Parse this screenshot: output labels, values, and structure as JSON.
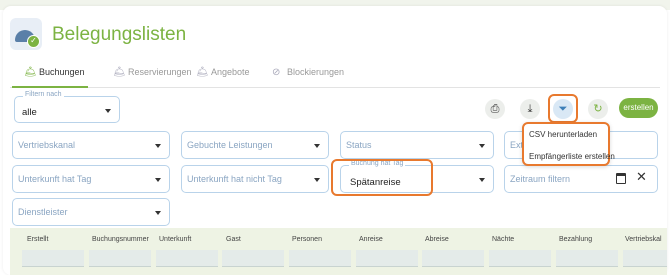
{
  "app": {
    "title": "Belegungslisten"
  },
  "tabs": [
    {
      "label": "Buchungen",
      "icon": "bell-icon"
    },
    {
      "label": "Reservierungen",
      "icon": "bell-icon"
    },
    {
      "label": "Angebote",
      "icon": "bell-icon"
    },
    {
      "label": "Blockierungen",
      "icon": "block-icon"
    }
  ],
  "filter": {
    "label": "Filtern nach",
    "value": "alle"
  },
  "toolbar": {
    "create_label": "erstellen"
  },
  "export_menu": {
    "items": [
      "CSV herunterladen",
      "Empfängerliste erstellen"
    ]
  },
  "filters": {
    "vertriebskanal": "Vertriebskanal",
    "gebuchte_leistungen": "Gebuchte Leistungen",
    "status": "Status",
    "ext": "Ext",
    "unterkunft_hat_tag": "Unterkunft hat Tag",
    "unterkunft_hat_nicht_tag": "Unterkunft hat nicht Tag",
    "buchung_hat_tag": {
      "label": "Buchung hat Tag",
      "value": "Spätanreise"
    },
    "zeitraum": "Zeitraum filtern",
    "dienstleister": "Dienstleister"
  },
  "table": {
    "columns": [
      "Erstellt",
      "Buchungsnummer",
      "Unterkunft",
      "Gast",
      "Personen",
      "Anreise",
      "Abreise",
      "Nächte",
      "Bezahlung",
      "Vertriebskal"
    ]
  },
  "colors": {
    "accent": "#7cb342",
    "highlight": "#e8792e",
    "border": "#b9d3ea"
  }
}
